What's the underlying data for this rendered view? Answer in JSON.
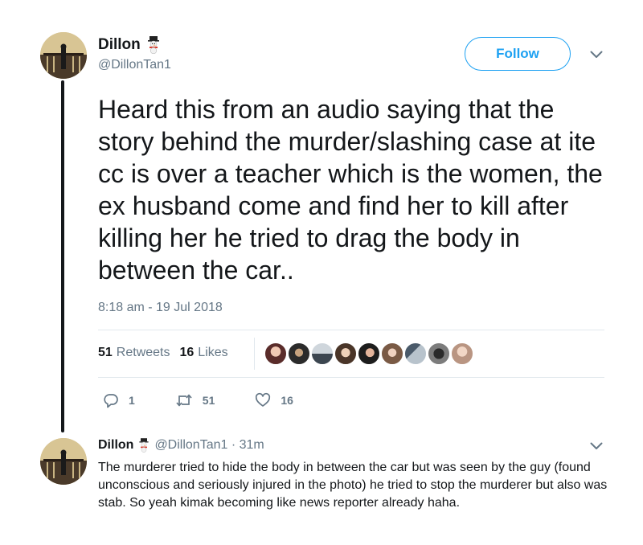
{
  "tweet": {
    "display_name": "Dillon",
    "handle": "@DillonTan1",
    "follow_label": "Follow",
    "text": "Heard this from an audio saying that the story behind the murder/slashing case at ite cc is over a teacher which is the women, the ex husband come and find her to kill after killing her he tried to drag the body in between the car..",
    "timestamp": "8:18 am - 19 Jul 2018",
    "retweets_count": "51",
    "retweets_label": "Retweets",
    "likes_count": "16",
    "likes_label": "Likes",
    "reply_action_count": "1",
    "retweet_action_count": "51",
    "like_action_count": "16"
  },
  "likers": [
    "liker-1",
    "liker-2",
    "liker-3",
    "liker-4",
    "liker-5",
    "liker-6",
    "liker-7",
    "liker-8",
    "liker-9",
    "liker-10"
  ],
  "reply": {
    "display_name": "Dillon",
    "handle_time": "@DillonTan1 · 31m",
    "text": "The murderer tried to hide the body in between the car but was seen by the guy (found unconscious and seriously injured in the photo) he tried to stop the murderer but also was stab. So yeah kimak becoming like news reporter already haha."
  },
  "colors": {
    "accent": "#1da1f2",
    "secondary_text": "#657786",
    "primary_text": "#14171a"
  },
  "icons": {
    "emoji": "snowman-emoji",
    "reply": "reply-icon",
    "retweet": "retweet-icon",
    "like": "heart-icon",
    "more": "chevron-down-icon"
  }
}
